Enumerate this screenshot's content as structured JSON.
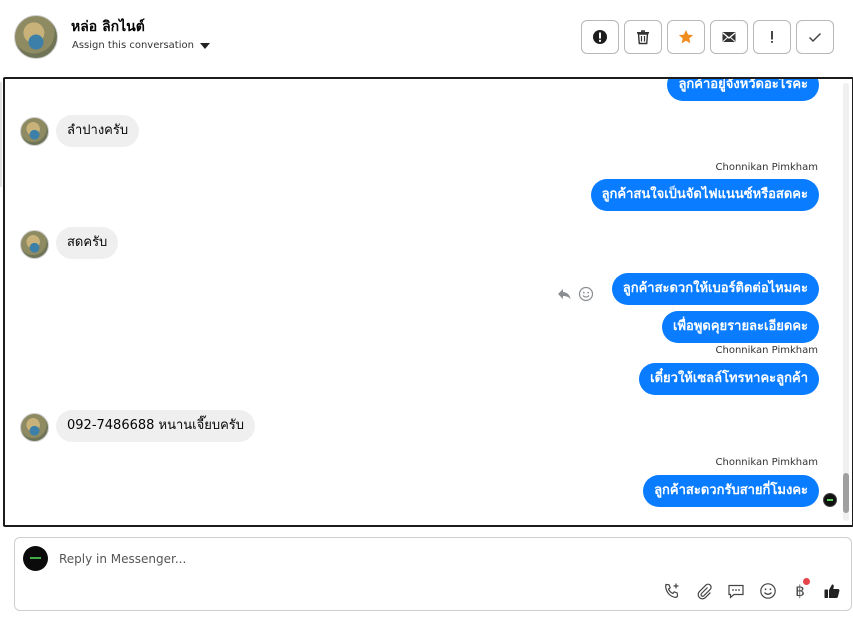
{
  "header": {
    "contact_name": "หล่อ ลิกไนต์",
    "assign_label": "Assign this conversation",
    "actions": [
      {
        "icon": "alert-circle-icon"
      },
      {
        "icon": "trash-icon"
      },
      {
        "icon": "star-icon",
        "color": "#f08b1d"
      },
      {
        "icon": "envelope-icon"
      },
      {
        "icon": "exclamation-icon"
      },
      {
        "icon": "check-icon"
      }
    ]
  },
  "messages": [
    {
      "direction": "out",
      "text": "ลูกค้าอยู่จังหวัดอะไรคะ"
    },
    {
      "direction": "in",
      "text": "ลำปางครับ"
    },
    {
      "direction": "out",
      "sender": "Chonnikan Pimkham",
      "text": "ลูกค้าสนใจเป็นจัดไฟแนนซ์หรือสดคะ"
    },
    {
      "direction": "in",
      "text": "สดครับ"
    },
    {
      "direction": "out",
      "text": "ลูกค้าสะดวกให้เบอร์ติดต่อไหมคะ"
    },
    {
      "direction": "out",
      "text": "เพื่อพูดคุยรายละเอียดคะ"
    },
    {
      "direction": "out",
      "sender": "Chonnikan Pimkham",
      "text": "เดี๋ยวให้เซลล์โทรหาคะลูกค้า"
    },
    {
      "direction": "in",
      "text": "092-7486688 หนานเจี๊ยบครับ"
    },
    {
      "direction": "out",
      "sender": "Chonnikan Pimkham",
      "text": "ลูกค้าสะดวกรับสายกี่โมงคะ"
    }
  ],
  "composer": {
    "placeholder": "Reply in Messenger...",
    "tools": [
      "phone-plus-icon",
      "paperclip-icon",
      "chat-bubble-icon",
      "smiley-icon",
      "baht-icon",
      "thumbs-up-icon"
    ],
    "baht_symbol": "฿"
  },
  "colors": {
    "outgoing_bubble": "#0a7cff",
    "incoming_bubble": "#efefef",
    "notification_dot": "#e4444a"
  }
}
